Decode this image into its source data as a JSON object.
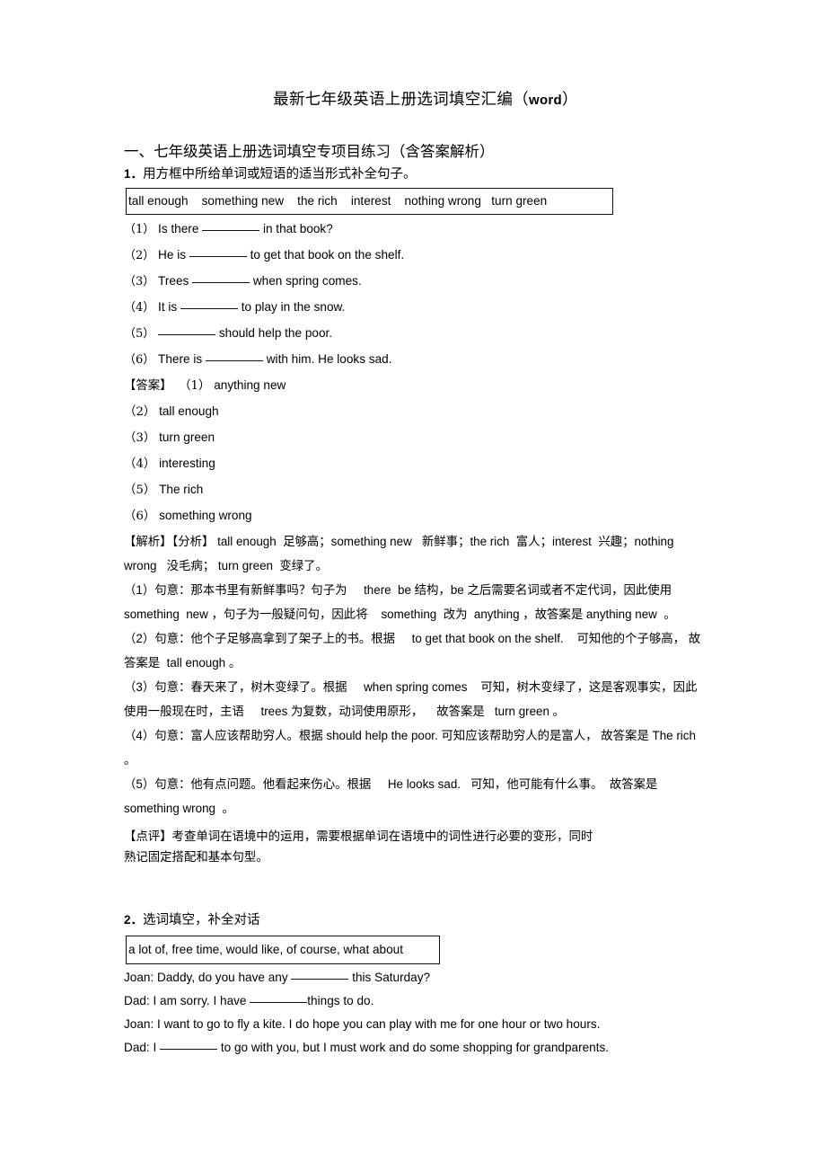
{
  "document": {
    "title_cn": "最新七年级英语上册选词填空汇编（",
    "title_word": "word",
    "title_close": "）",
    "section_heading": "一、七年级英语上册选词填空专项目练习（含答案解析）"
  },
  "q1": {
    "number": "1．",
    "instruction": "用方框中所给单词或短语的适当形式补全句子。",
    "wordbank": "tall enough    something new    the rich    interest    nothing wrong   turn green",
    "wordbank_items": [
      "tall enough",
      "something new",
      "the rich",
      "interest",
      "nothing wrong",
      "turn green"
    ],
    "items": [
      {
        "label": "（1）",
        "before": " Is there ",
        "after": " in that book?"
      },
      {
        "label": "（2）",
        "before": " He is ",
        "after": " to get that book on the shelf."
      },
      {
        "label": "（3）",
        "before": " Trees ",
        "after": " when spring comes."
      },
      {
        "label": "（4）",
        "before": " It is ",
        "after": " to play in the snow."
      },
      {
        "label": "（5）",
        "before": " ",
        "after": " should help the poor."
      },
      {
        "label": "（6）",
        "before": " There is ",
        "after": " with him. He looks sad."
      }
    ],
    "answers_label": "【答案】",
    "answers": [
      {
        "label": "（1）",
        "text": " anything new"
      },
      {
        "label": "（2）",
        "text": " tall enough"
      },
      {
        "label": "（3）",
        "text": " turn green"
      },
      {
        "label": "（4）",
        "text": " interesting"
      },
      {
        "label": "（5）",
        "text": " The rich"
      },
      {
        "label": "（6）",
        "text": " something wrong"
      }
    ],
    "analysis": {
      "head": "【解析】【分析】 tall enough  足够高；something new   新鲜事；the rich  富人；interest  兴趣；nothing wrong   没毛病； turn green  变绿了。",
      "p1": "（1）句意：那本书里有新鲜事吗？句子为     there  be 结构，be 之后需要名词或者不定代词，因此使用  something  new ，句子为一般疑问句，因此将    something  改为  anything ，故答案是 anything new  。",
      "p2": "（2）句意：他个子足够高拿到了架子上的书。根据     to get that book on the shelf.    可知他的个子够高， 故答案是  tall enough 。",
      "p3": "（3）句意：春天来了，树木变绿了。根据     when spring comes    可知，树木变绿了，这是客观事实，因此使用一般现在时，主语     trees 为复数，动词使用原形，    故答案是   turn green 。",
      "p4": "（4）句意：富人应该帮助穷人。根据 should help the poor. 可知应该帮助穷人的是富人， 故答案是 The rich 。",
      "p5": "（5）句意：他有点问题。他看起来伤心。根据     He looks sad.   可知，他可能有什么事。  故答案是 something wrong  。",
      "comment_line1": "【点评】考查单词在语境中的运用，需要根据单词在语境中的词性进行必要的变形，同时",
      "comment_line2": "熟记固定搭配和基本句型。"
    }
  },
  "q2": {
    "number": "2．",
    "instruction": "选词填空，补全对话",
    "wordbank": "a lot of, free time, would like, of course, what about",
    "wordbank_items": [
      "a lot of",
      "free time",
      "would like",
      "of course",
      "what about"
    ],
    "dialogue": [
      {
        "speaker": "Joan:",
        "before": " Daddy, do you have any ",
        "after": " this Saturday?"
      },
      {
        "speaker": "Dad:",
        "before": " I am sorry. I have ",
        "after": "things to do."
      },
      {
        "speaker": "Joan:",
        "before": " I want to go to fly a kite. I do hope you can play with me for one hour or two hours.",
        "after": ""
      },
      {
        "speaker": "Dad:",
        "before": " I ",
        "after": " to go with you, but I must work and do some shopping for grandparents."
      }
    ]
  }
}
